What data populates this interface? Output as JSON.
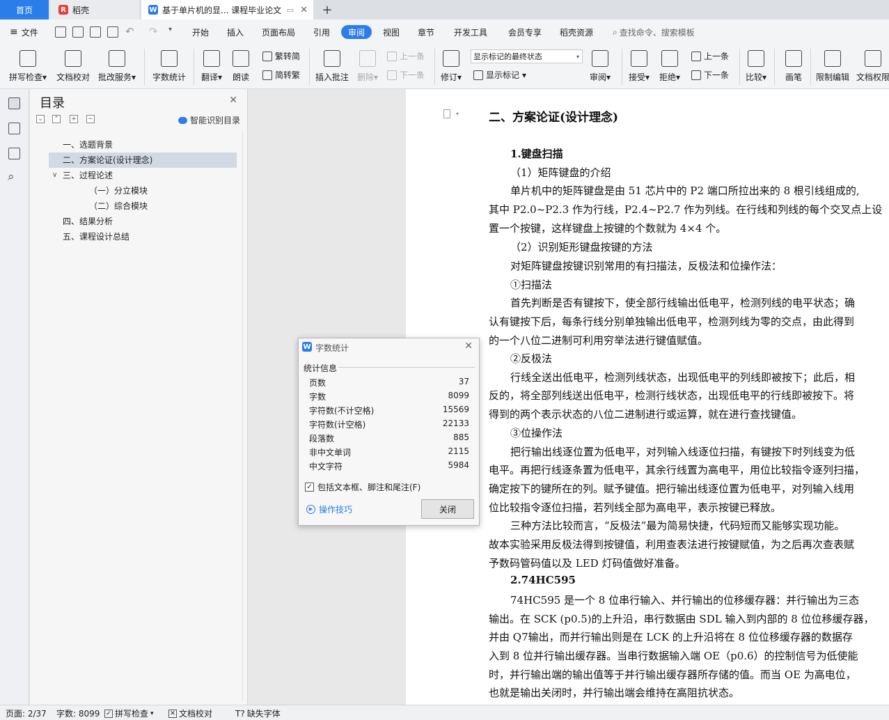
{
  "tabs": {
    "home": "首页",
    "daoke": "稻壳",
    "doc": "基于单片机的显... 课程毕业论文",
    "add": "+"
  },
  "menu": {
    "file": "文件",
    "items": [
      "开始",
      "插入",
      "页面布局",
      "引用",
      "审阅",
      "视图",
      "章节",
      "开发工具",
      "会员专享",
      "稻壳资源"
    ],
    "active": "审阅",
    "search": "查找命令、搜索模板"
  },
  "ribbon": {
    "spell": "拼写检查",
    "proof": "文档校对",
    "service": "批改服务",
    "wordcount": "字数统计",
    "translate": "翻译",
    "read": "朗读",
    "trad": "繁转简",
    "simp": "简转繁",
    "insert_comment": "插入批注",
    "delete": "删除",
    "prev_comment": "上一条",
    "next_comment": "下一条",
    "revise": "修订",
    "markup_state": "显示标记的最终状态",
    "show_markup": "显示标记",
    "review": "审阅",
    "accept": "接受",
    "reject": "拒绝",
    "prev": "上一条",
    "next": "下一条",
    "compare": "比较",
    "pen": "画笔",
    "restrict": "限制编辑",
    "perm": "文档权限"
  },
  "toc": {
    "title": "目录",
    "smart": "智能识别目录",
    "items": [
      "一、选题背景",
      "二、方案论证(设计理念)",
      "三、过程论述",
      "（一）分立模块",
      "（二）综合模块",
      "四、结果分析",
      "五、课程设计总结"
    ],
    "selected": "二、方案论证(设计理念)"
  },
  "doc": {
    "lines": [
      "二、方案论证(设计理念)",
      "1.键盘扫描",
      "（1）矩阵键盘的介绍",
      "单片机中的矩阵键盘是由 51 芯片中的 P2 端口所拉出来的 8 根引线组成的,",
      "其中 P2.0~P2.3 作为行线，P2.4~P2.7 作为列线。在行线和列线的每个交叉点上设",
      "置一个按键，这样键盘上按键的个数就为 4×4 个。",
      "（2）识别矩形键盘按键的方法",
      "对矩阵键盘按键识别常用的有扫描法，反极法和位操作法：",
      "①扫描法",
      "首先判断是否有键按下，使全部行线输出低电平，检测列线的电平状态；确",
      "认有键按下后，每条行线分别单独输出低电平，检测列线为零的交点，由此得到",
      "的一个八位二进制可利用穷举法进行键值赋值。",
      "②反极法",
      "行线全送出低电平，检测列线状态，出现低电平的列线即被按下；此后，相",
      "反的，将全部列线送出低电平，检测行线状态，出现低电平的行线即被按下。将",
      "得到的两个表示状态的八位二进制进行或运算，就在进行查找键值。",
      "③位操作法",
      "把行输出线逐位置为低电平，对列输入线逐位扫描，有键按下时列线变为低",
      "电平。再把行线逐条置为低电平，其余行线置为高电平，用位比较指令逐列扫描，",
      "确定按下的键所在的列。赋予键值。把行输出线逐位置为低电平，对列输入线用",
      "位比较指令逐位扫描，若列线全部为高电平，表示按键已释放。",
      "三种方法比较而言，“反极法”最为简易快捷，代码短而又能够实现功能。",
      "故本实验采用反极法得到按键值，利用查表法进行按键赋值，为之后再次查表赋",
      "予数码管码值以及 LED 灯码值做好准备。",
      "2.74HC595",
      "74HC595 是一个 8 位串行输入、并行输出的位移缓存器：并行输出为三态",
      "输出。在 SCK (p0.5)的上升沿，串行数据由 SDL 输入到内部的 8 位位移缓存器，",
      "并由 Q7输出，而并行输出则是在 LCK 的上升沿将在 8 位位移缓存器的数据存",
      "入到 8 位并行输出缓存器。当串行数据输入端 OE（p0.6）的控制信号为低使能",
      "时，并行输出端的输出值等于并行输出缓存器所存储的值。而当 OE 为高电位，",
      "也就是输出关闭时，并行输出端会维持在高阻抗状态。"
    ]
  },
  "wordcount": {
    "title": "字数统计",
    "section": "统计信息",
    "rows": [
      {
        "label": "页数",
        "value": "37"
      },
      {
        "label": "字数",
        "value": "8099"
      },
      {
        "label": "字符数(不计空格)",
        "value": "15569"
      },
      {
        "label": "字符数(计空格)",
        "value": "22133"
      },
      {
        "label": "段落数",
        "value": "885"
      },
      {
        "label": "非中文单词",
        "value": "2115"
      },
      {
        "label": "中文字符",
        "value": "5984"
      }
    ],
    "include": "包括文本框、脚注和尾注(F)",
    "tips": "操作技巧",
    "close": "关闭"
  },
  "status": {
    "page": "页面: 2/37",
    "words": "字数: 8099",
    "spell": "拼写检查",
    "proof": "文档校对",
    "font": "缺失字体"
  }
}
